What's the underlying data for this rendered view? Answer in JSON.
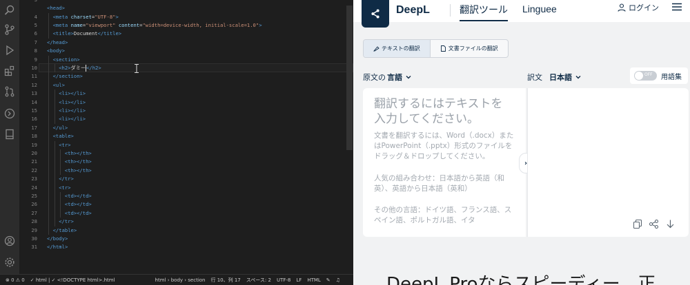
{
  "vscode": {
    "lines": [
      {
        "n": "4",
        "indent": 1,
        "parts": [
          [
            "tag",
            "<"
          ],
          [
            "tag",
            "meta "
          ],
          [
            "attr",
            "charset"
          ],
          [
            "txt",
            "="
          ],
          [
            "str",
            "\"UTF-8\""
          ],
          [
            "tag",
            ">"
          ]
        ]
      },
      {
        "n": "5",
        "indent": 1,
        "parts": [
          [
            "tag",
            "<meta "
          ],
          [
            "attr",
            "name"
          ],
          [
            "txt",
            "="
          ],
          [
            "str",
            "\"viewport\" "
          ],
          [
            "attr",
            "content"
          ],
          [
            "txt",
            "="
          ],
          [
            "str",
            "\"width=device-width, initial-scale=1.0\""
          ],
          [
            "tag",
            ">"
          ]
        ]
      },
      {
        "n": "6",
        "indent": 1,
        "parts": [
          [
            "tag",
            "<title>"
          ],
          [
            "txt",
            "Document"
          ],
          [
            "tag",
            "</title>"
          ]
        ]
      },
      {
        "n": "7",
        "indent": 0,
        "parts": [
          [
            "tag",
            "</head>"
          ]
        ]
      },
      {
        "n": "8",
        "indent": 0,
        "parts": [
          [
            "tag",
            "<body>"
          ]
        ]
      },
      {
        "n": "9",
        "indent": 1,
        "parts": [
          [
            "tag",
            "<section>"
          ]
        ]
      },
      {
        "n": "10",
        "indent": 2,
        "parts": [
          [
            "tag",
            "<h2>"
          ],
          [
            "txt",
            "ダミー"
          ],
          [
            "caret",
            ""
          ],
          [
            "tag",
            "</h2>"
          ]
        ]
      },
      {
        "n": "11",
        "indent": 1,
        "parts": [
          [
            "tag",
            "</section>"
          ]
        ]
      },
      {
        "n": "12",
        "indent": 1,
        "parts": [
          [
            "tag",
            "<ul>"
          ]
        ]
      },
      {
        "n": "13",
        "indent": 2,
        "parts": [
          [
            "tag",
            "<li></li>"
          ]
        ]
      },
      {
        "n": "14",
        "indent": 2,
        "parts": [
          [
            "tag",
            "<li></li>"
          ]
        ]
      },
      {
        "n": "15",
        "indent": 2,
        "parts": [
          [
            "tag",
            "<li></li>"
          ]
        ]
      },
      {
        "n": "16",
        "indent": 2,
        "parts": [
          [
            "tag",
            "<li></li>"
          ]
        ]
      },
      {
        "n": "17",
        "indent": 1,
        "parts": [
          [
            "tag",
            "</ul>"
          ]
        ]
      },
      {
        "n": "18",
        "indent": 1,
        "parts": [
          [
            "tag",
            "<table>"
          ]
        ]
      },
      {
        "n": "19",
        "indent": 2,
        "parts": [
          [
            "tag",
            "<tr>"
          ]
        ]
      },
      {
        "n": "20",
        "indent": 3,
        "parts": [
          [
            "tag",
            "<th></th>"
          ]
        ]
      },
      {
        "n": "21",
        "indent": 3,
        "parts": [
          [
            "tag",
            "<th></th>"
          ]
        ]
      },
      {
        "n": "22",
        "indent": 3,
        "parts": [
          [
            "tag",
            "<th></th>"
          ]
        ]
      },
      {
        "n": "23",
        "indent": 2,
        "parts": [
          [
            "tag",
            "</tr>"
          ]
        ]
      },
      {
        "n": "24",
        "indent": 2,
        "parts": [
          [
            "tag",
            "<tr>"
          ]
        ]
      },
      {
        "n": "25",
        "indent": 3,
        "parts": [
          [
            "tag",
            "<td></td>"
          ]
        ]
      },
      {
        "n": "26",
        "indent": 3,
        "parts": [
          [
            "tag",
            "<td></td>"
          ]
        ]
      },
      {
        "n": "27",
        "indent": 3,
        "parts": [
          [
            "tag",
            "<td></td>"
          ]
        ]
      },
      {
        "n": "28",
        "indent": 2,
        "parts": [
          [
            "tag",
            "</tr>"
          ]
        ]
      },
      {
        "n": "29",
        "indent": 1,
        "parts": [
          [
            "tag",
            "</table>"
          ]
        ]
      },
      {
        "n": "30",
        "indent": 0,
        "parts": [
          [
            "tag",
            "</body>"
          ]
        ]
      },
      {
        "n": "31",
        "indent": 0,
        "parts": [
          [
            "tag",
            "</html>"
          ]
        ]
      }
    ],
    "head_line": {
      "n": "3",
      "text": "<head>"
    },
    "status": {
      "problems": "⊗ 0 ⚠ 0",
      "lang_check": "✓ html | ✓ <!DOCTYPE html>.html",
      "breadcrumb": "html › body › section",
      "position": "行 10、列 17",
      "spaces": "スペース: 2",
      "encoding": "UTF-8",
      "eol": "LF",
      "language": "HTML"
    }
  },
  "deepl": {
    "brand": "DeepL",
    "tab_translate": "翻訳ツール",
    "tab_linguee": "Linguee",
    "login": "ログイン",
    "mode_text": "テキストの翻訳",
    "mode_file": "文書ファイルの翻訳",
    "source_label": "原文の",
    "source_lang": "言語",
    "target_label": "訳文",
    "target_lang": "日本語",
    "toggle_state": "OFF",
    "glossary": "用語集",
    "placeholder": "翻訳するにはテキストを入力してください。",
    "help": "文書を翻訳するには、Word（.docx）またはPowerPoint（.pptx）形式のファイルをドラッグ＆ドロップしてください。",
    "combo": "人気の組み合わせ：日本語から英語（和英）、英語から日本語（英和）",
    "other": "その他の言語：ドイツ語、フランス語、スペイン語、ポルトガル語、イタ",
    "promo": "DeepL Proならスピーディー、正"
  }
}
